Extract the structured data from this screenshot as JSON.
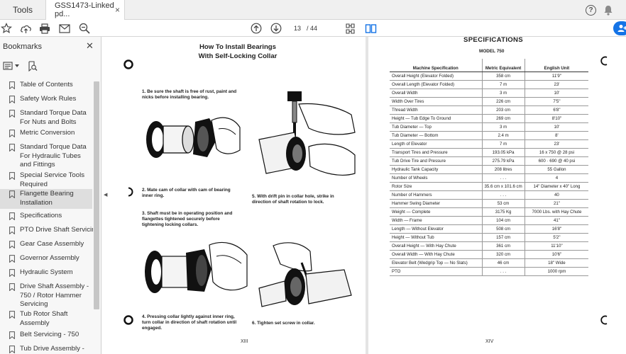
{
  "tabs": {
    "tools": "Tools",
    "document": "GSS1473-Linked pd...",
    "close": "×"
  },
  "toolbar": {
    "current_page": "13",
    "page_total": "/ 44"
  },
  "sidebar": {
    "title": "Bookmarks",
    "bookmarks": [
      {
        "label": "Table of Contents",
        "selected": false
      },
      {
        "label": "Safety Work Rules",
        "selected": false
      },
      {
        "label": "Standard Torque Data For Nuts and Bolts",
        "selected": false
      },
      {
        "label": "Metric Conversion",
        "selected": false
      },
      {
        "label": "Standard Torque Data For Hydraulic Tubes and Fittings",
        "selected": false
      },
      {
        "label": "Special Service Tools Required",
        "selected": false
      },
      {
        "label": "Flangette Bearing Installation",
        "selected": true
      },
      {
        "label": "Specifications",
        "selected": false
      },
      {
        "label": "PTO Drive Shaft Servicing",
        "selected": false
      },
      {
        "label": "Gear Case Assembly",
        "selected": false
      },
      {
        "label": "Governor Assembly",
        "selected": false
      },
      {
        "label": "Hydraulic System",
        "selected": false
      },
      {
        "label": "Drive Shaft Assembly - 750 / Rotor Hammer Servicing",
        "selected": false
      },
      {
        "label": "Tub Rotor Shaft Assembly",
        "selected": false
      },
      {
        "label": "Belt Servicing - 750",
        "selected": false
      },
      {
        "label": "Tub Drive Assembly -",
        "selected": false
      }
    ]
  },
  "left_page": {
    "title_line1": "How To Install Bearings",
    "title_line2": "With Self-Locking Collar",
    "steps": [
      "1.  Be sure the shaft is free of rust, paint and nicks before installing bearing.",
      "2.  Mate cam of collar with cam of bearing inner ring.",
      "3.  Shaft must be in operating position and flangettes tightened securely before tightening locking collars.",
      "4.  Pressing collar lightly against inner ring, turn collar in direction of shaft rotation until engaged.",
      "5.  With drift pin in collar hole, strike in direction of shaft rotation to lock.",
      "6.  Tighten set screw in collar."
    ],
    "page_number": "XIII"
  },
  "right_page": {
    "heading": "SPECIFICATIONS",
    "model": "MODEL 750",
    "columns": [
      "Machine Specification",
      "Metric Equivalent",
      "English Unit"
    ],
    "rows": [
      [
        "Overall Height (Elevator Folded)",
        "358 cm",
        "11'9\""
      ],
      [
        "Overall Length (Elevator Folded)",
        "7 m",
        "23'"
      ],
      [
        "Overall Width",
        "3 m",
        "10'"
      ],
      [
        "Width Over Tires",
        "226 cm",
        "7'5\""
      ],
      [
        "Thread Width",
        "203 cm",
        "6'8\""
      ],
      [
        "Height — Tub Edge To Ground",
        "269 cm",
        "8'10\""
      ],
      [
        "Tub Diameter — Top",
        "3 m",
        "10'"
      ],
      [
        "Tub Diameter — Bottom",
        "2.4 m",
        "8'"
      ],
      [
        "Length of Elevator",
        "7 m",
        "23'"
      ],
      [
        "Transport Tires and Pressure",
        "193.05 kPa",
        "16 x 750 @ 28 psi"
      ],
      [
        "Tub Drive Tire and Pressure",
        "275.79 kPa",
        "600 · 690 @ 40 psi"
      ],
      [
        "Hydraulic Tank Capacity",
        "208 litres",
        "55 Gallon"
      ],
      [
        "Number of Wheels",
        ". . .",
        "4"
      ],
      [
        "Rotor Size",
        "35.6 cm x 101.6 cm",
        "14\" Diameter x 40\" Long"
      ],
      [
        "Number of Hammers",
        ". . .",
        "40"
      ],
      [
        "Hammer Swing Diameter",
        "53 cm",
        "21\""
      ],
      [
        "Weight — Complete",
        "3175 Kg",
        "7000 Lbs. with Hay Chute"
      ],
      [
        "Width — Frame",
        "104 cm",
        "41\""
      ],
      [
        "Length — Without Elevator",
        "508 cm",
        "16'8\""
      ],
      [
        "Height — Without Tub",
        "157 cm",
        "5'2\""
      ],
      [
        "Overall Height — With Hay Chute",
        "361 cm",
        "11'10\""
      ],
      [
        "Overall Width — With Hay Chute",
        "320 cm",
        "10'6\""
      ],
      [
        "Elevator Belt (Wedgrip Top — No Slats)",
        "46 cm",
        "18\" Wide"
      ],
      [
        "PTO",
        ". . .",
        "1000 rpm"
      ]
    ],
    "page_number": "XIV"
  },
  "colors": {
    "accent": "#1473e6",
    "selected_bookmark": "#dedede"
  }
}
